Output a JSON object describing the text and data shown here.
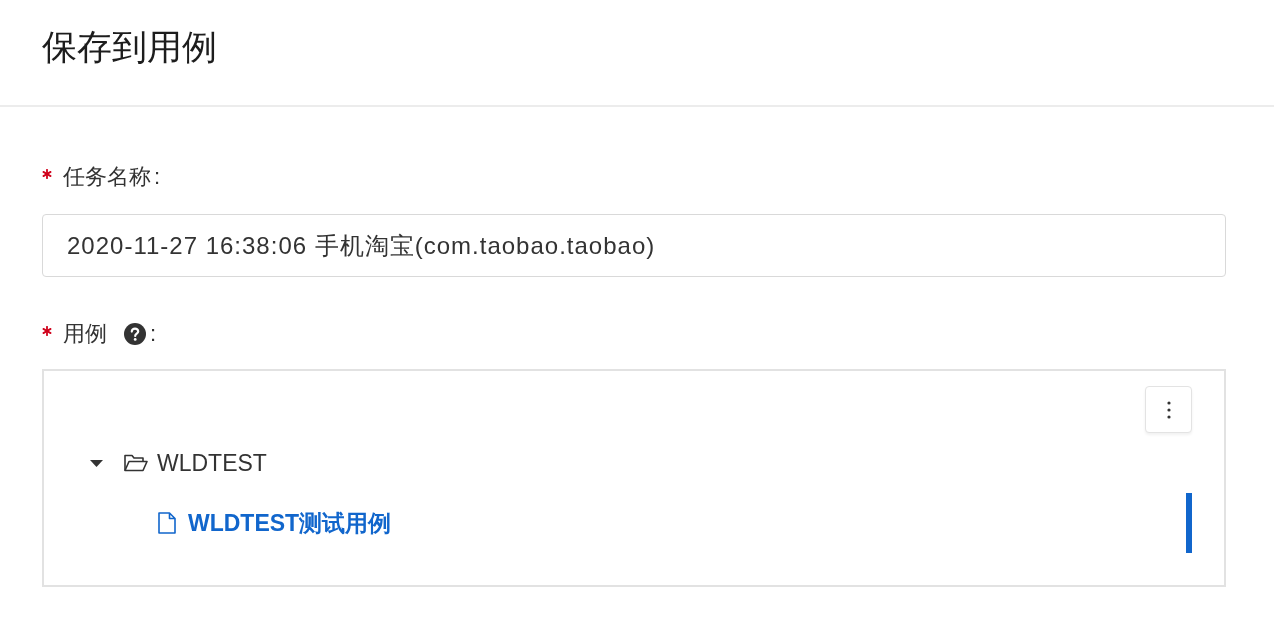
{
  "dialog": {
    "title": "保存到用例"
  },
  "fields": [
    {
      "kind": "text",
      "required": true,
      "label": "任务名称",
      "suffix": ":",
      "value": "2020-11-27 16:38:06 手机淘宝(com.taobao.taobao)"
    },
    {
      "kind": "tree",
      "required": true,
      "label": "用例",
      "help": true,
      "suffix": ":",
      "items": [
        {
          "kind": "folder",
          "label": "WLDTEST",
          "expanded": true,
          "selected": false,
          "children": [
            {
              "kind": "file",
              "label": "WLDTEST测试用例",
              "selected": true
            }
          ]
        }
      ]
    }
  ]
}
